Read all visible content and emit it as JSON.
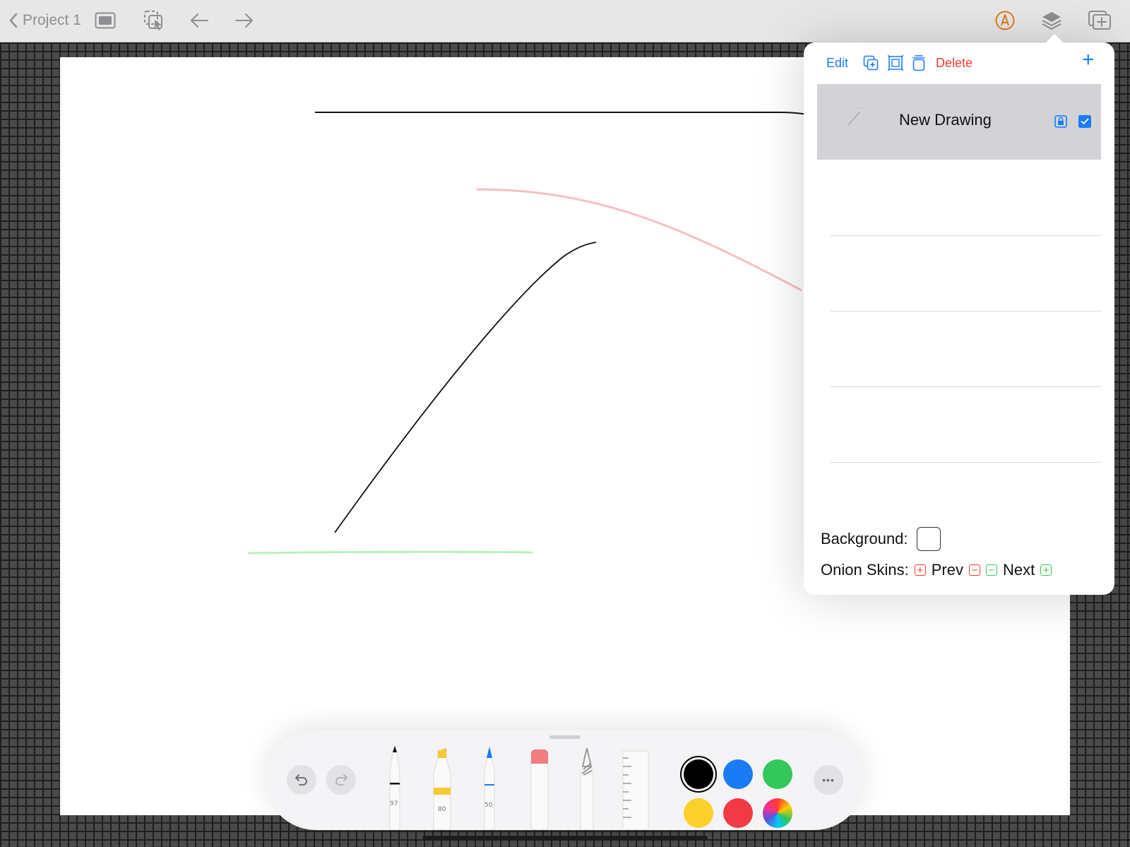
{
  "topbar": {
    "back_label": "Project 1",
    "icons": [
      "chevron-left-icon",
      "screen-icon",
      "select-icon",
      "arrow-left-icon",
      "arrow-right-icon",
      "pencil-circle-icon",
      "layers-icon",
      "add-frame-icon"
    ],
    "accent_color": "#e07a1f"
  },
  "layers_panel": {
    "edit_label": "Edit",
    "delete_label": "Delete",
    "add_label": "+",
    "layer": {
      "name": "New Drawing",
      "visible": true
    },
    "background_label": "Background:",
    "background_color": "#ffffff",
    "onion_label": "Onion Skins:",
    "prev_label": "Prev",
    "next_label": "Next"
  },
  "palette": {
    "pen_width": "97",
    "marker_width": "80",
    "pencil_width": "50",
    "colors": [
      "#000000",
      "#1a7cf5",
      "#34c759",
      "#fdd02b",
      "#f23a45",
      "multicolor"
    ],
    "selected_color": "#000000",
    "more_label": "•••"
  },
  "colors": {
    "link_blue": "#1a7cf5",
    "delete_red": "#f23a2f",
    "onion_prev": "#f23a2f",
    "onion_next": "#34c759"
  }
}
